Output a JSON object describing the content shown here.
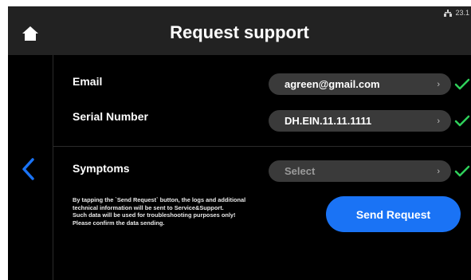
{
  "colors": {
    "accent": "#1a73f5",
    "check": "#2fd05a",
    "field_bg": "#3a3a3a",
    "header_bg": "#222222"
  },
  "status_bar": {
    "icon": "network-icon",
    "value": "23.1"
  },
  "header": {
    "title": "Request support",
    "home_icon": "home-icon"
  },
  "navigation": {
    "back_icon": "chevron-left-icon"
  },
  "form": {
    "email": {
      "label": "Email",
      "value": "agreen@gmail.com",
      "valid": true
    },
    "serial": {
      "label": "Serial Number",
      "value": "DH.EIN.11.11.1111",
      "valid": true
    },
    "symptoms": {
      "label": "Symptoms",
      "placeholder": "Select",
      "valid": true
    }
  },
  "notice": {
    "lines": [
      "By tapping the `Send Request` button, the logs and additional",
      "technical information will be sent to Service&Support.",
      "Such data will be used for troubleshooting purposes only!",
      "Please confirm the data sending."
    ]
  },
  "actions": {
    "send_label": "Send Request"
  }
}
